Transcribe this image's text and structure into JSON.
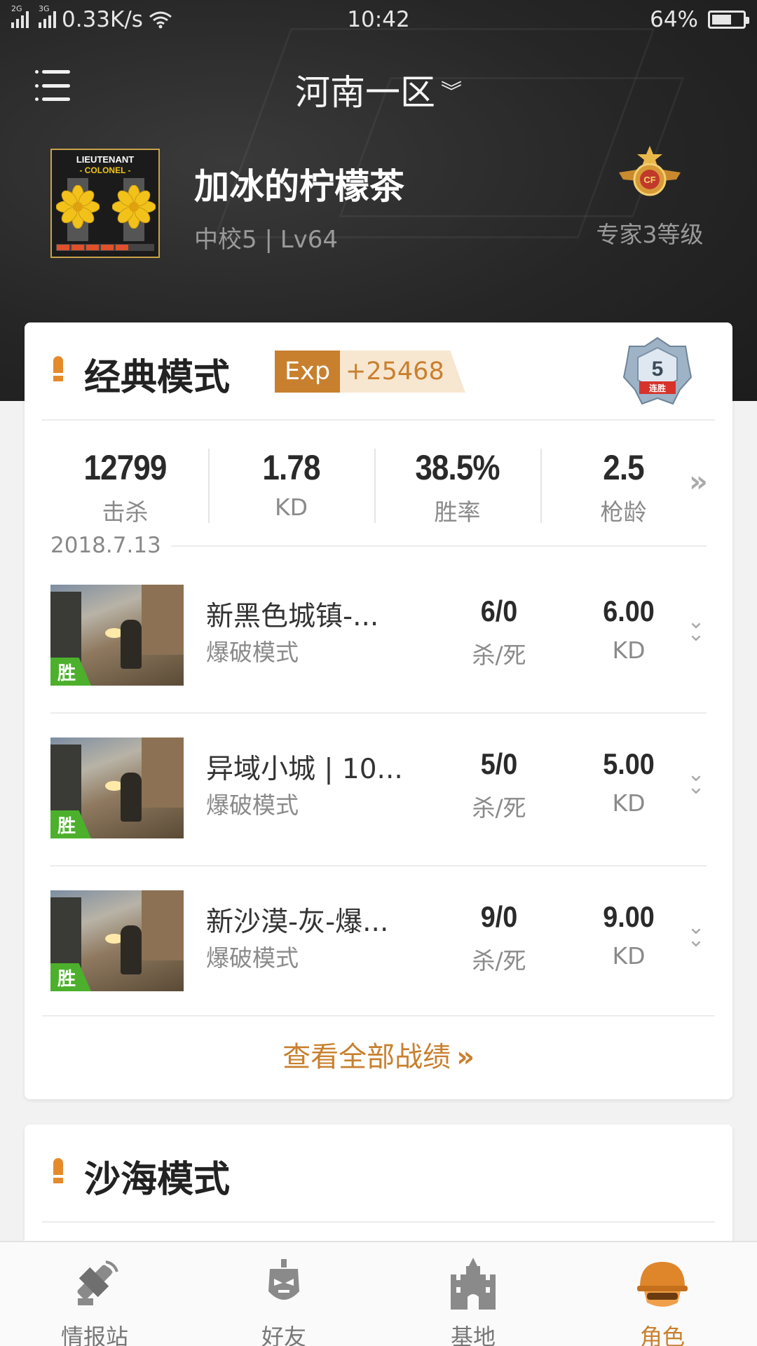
{
  "status_bar": {
    "net1": "2G",
    "net2": "3G",
    "speed": "0.33K/s",
    "time": "10:42",
    "battery_pct": "64%",
    "battery_level": 0.64
  },
  "header": {
    "region": "河南一区"
  },
  "profile": {
    "badge_line1": "LIEUTENANT",
    "badge_line2": "- COLONEL -",
    "nickname": "加冰的柠檬茶",
    "rank_level": "中校5 | Lv64",
    "expert_label": "专家3等级",
    "expert_emblem_text": "CF"
  },
  "classic": {
    "title": "经典模式",
    "exp_key": "Exp",
    "exp_value": "+25468",
    "streak_number": "5",
    "streak_label": "连胜",
    "stats": [
      {
        "value": "12799",
        "label": "击杀"
      },
      {
        "value": "1.78",
        "label": "KD"
      },
      {
        "value": "38.5%",
        "label": "胜率"
      },
      {
        "value": "2.5",
        "label": "枪龄"
      }
    ],
    "date": "2018.7.13",
    "matches": [
      {
        "name": "新黑色城镇-...",
        "mode": "爆破模式",
        "result": "胜",
        "kills_deaths": "6/0",
        "kd_label": "杀/死",
        "kd": "6.00",
        "kd_unit": "KD"
      },
      {
        "name": "异域小城 | 10...",
        "mode": "爆破模式",
        "result": "胜",
        "kills_deaths": "5/0",
        "kd_label": "杀/死",
        "kd": "5.00",
        "kd_unit": "KD"
      },
      {
        "name": "新沙漠-灰-爆...",
        "mode": "爆破模式",
        "result": "胜",
        "kills_deaths": "9/0",
        "kd_label": "杀/死",
        "kd": "9.00",
        "kd_unit": "KD"
      }
    ],
    "view_all": "查看全部战绩"
  },
  "sand": {
    "title": "沙海模式"
  },
  "tabs": [
    {
      "label": "情报站",
      "icon": "satellite-icon"
    },
    {
      "label": "好友",
      "icon": "friends-icon"
    },
    {
      "label": "基地",
      "icon": "castle-icon"
    },
    {
      "label": "角色",
      "icon": "helmet-icon",
      "active": true
    }
  ],
  "colors": {
    "accent": "#c8802f",
    "win_green": "#4cb02c",
    "header_dark": "#262626"
  }
}
